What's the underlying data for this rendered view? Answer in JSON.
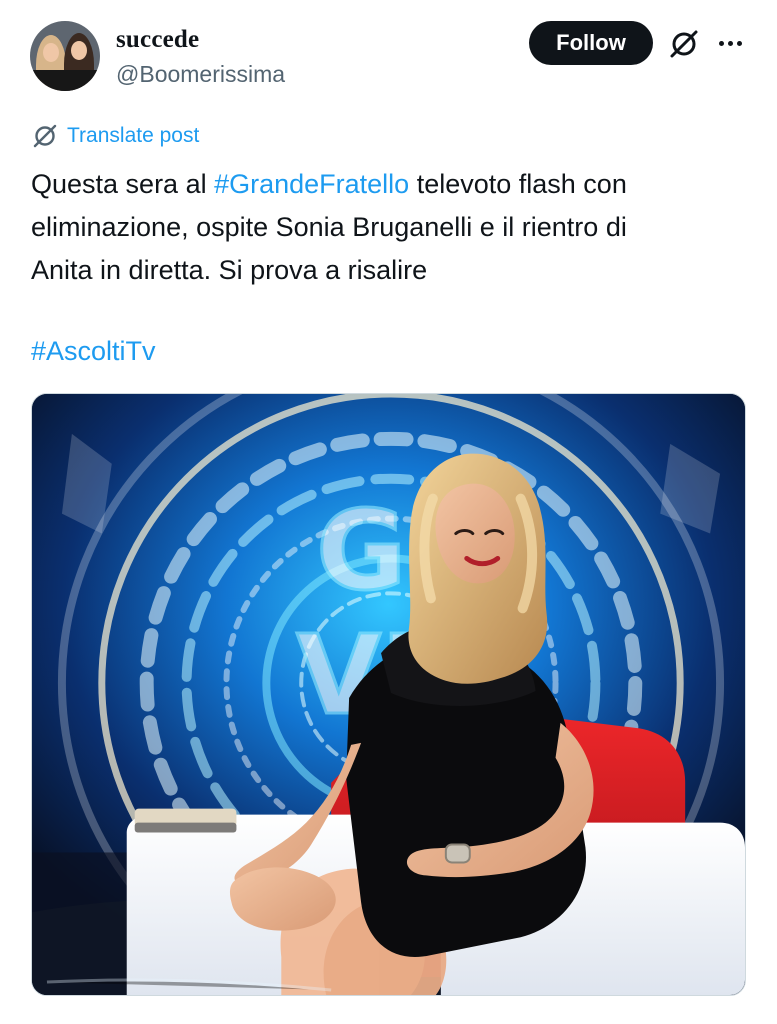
{
  "author": {
    "display_name": "succede",
    "handle": "@Boomerissima",
    "avatar_icon": "profile-photo-two-women"
  },
  "actions": {
    "follow_label": "Follow",
    "grok_icon": "grok-icon",
    "more_icon": "more-options-icon"
  },
  "post": {
    "translate_label": "Translate post",
    "text_part1": "Questa sera al ",
    "hashtag1": "#GrandeFratello",
    "text_part2": " televoto flash con",
    "line2": "eliminazione, ospite Sonia Bruganelli e il rientro di",
    "line3": "Anita in diretta. Si prova a risalire",
    "hashtag2": "#AscoltiTv"
  },
  "media": {
    "image_icon": "studio-photo-woman-seated",
    "set_text": "GF VIP"
  },
  "colors": {
    "link": "#1d9bf0",
    "text": "#0f1419",
    "secondary": "#536471",
    "follow_bg": "#0f1419"
  }
}
